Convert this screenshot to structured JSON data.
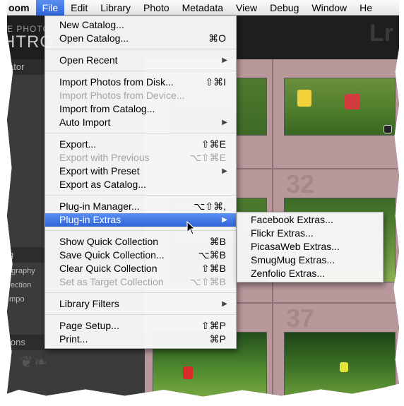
{
  "menubar": {
    "items": [
      {
        "label": "oom"
      },
      {
        "label": "File"
      },
      {
        "label": "Edit"
      },
      {
        "label": "Library"
      },
      {
        "label": "Photo"
      },
      {
        "label": "Metadata"
      },
      {
        "label": "View"
      },
      {
        "label": "Debug"
      },
      {
        "label": "Window"
      },
      {
        "label": "He"
      }
    ]
  },
  "background": {
    "brand_line1": "E PHOTO",
    "brand_line2": "HTRO",
    "panel_header_top": "ator",
    "panel_header_mid": "g",
    "panel_header_bottom": "ions",
    "panel_items": [
      "ography",
      "llection",
      "Impo"
    ],
    "grid_numbers": [
      "32",
      "37"
    ]
  },
  "file_menu": {
    "items": [
      {
        "label": "New Catalog...",
        "shortcut": "",
        "submenu": false,
        "disabled": false
      },
      {
        "label": "Open Catalog...",
        "shortcut": "⌘O",
        "submenu": false,
        "disabled": false
      },
      {
        "label": "Open Recent",
        "shortcut": "",
        "submenu": true,
        "disabled": false
      },
      {
        "label": "Import Photos from Disk...",
        "shortcut": "⇧⌘I",
        "submenu": false,
        "disabled": false
      },
      {
        "label": "Import Photos from Device...",
        "shortcut": "",
        "submenu": false,
        "disabled": true
      },
      {
        "label": "Import from Catalog...",
        "shortcut": "",
        "submenu": false,
        "disabled": false
      },
      {
        "label": "Auto Import",
        "shortcut": "",
        "submenu": true,
        "disabled": false
      },
      {
        "label": "Export...",
        "shortcut": "⇧⌘E",
        "submenu": false,
        "disabled": false
      },
      {
        "label": "Export with Previous",
        "shortcut": "⌥⇧⌘E",
        "submenu": false,
        "disabled": true
      },
      {
        "label": "Export with Preset",
        "shortcut": "",
        "submenu": true,
        "disabled": false
      },
      {
        "label": "Export as Catalog...",
        "shortcut": "",
        "submenu": false,
        "disabled": false
      },
      {
        "label": "Plug-in Manager...",
        "shortcut": "⌥⇧⌘,",
        "submenu": false,
        "disabled": false
      },
      {
        "label": "Plug-in Extras",
        "shortcut": "",
        "submenu": true,
        "disabled": false,
        "highlighted": true
      },
      {
        "label": "Show Quick Collection",
        "shortcut": "⌘B",
        "submenu": false,
        "disabled": false
      },
      {
        "label": "Save Quick Collection...",
        "shortcut": "⌥⌘B",
        "submenu": false,
        "disabled": false
      },
      {
        "label": "Clear Quick Collection",
        "shortcut": "⇧⌘B",
        "submenu": false,
        "disabled": false
      },
      {
        "label": "Set as Target Collection",
        "shortcut": "⌥⇧⌘B",
        "submenu": false,
        "disabled": true
      },
      {
        "label": "Library Filters",
        "shortcut": "",
        "submenu": true,
        "disabled": false
      },
      {
        "label": "Page Setup...",
        "shortcut": "⇧⌘P",
        "submenu": false,
        "disabled": false
      },
      {
        "label": "Print...",
        "shortcut": "⌘P",
        "submenu": false,
        "disabled": false
      }
    ]
  },
  "plugin_extras_submenu": {
    "items": [
      {
        "label": "Facebook Extras..."
      },
      {
        "label": "Flickr Extras..."
      },
      {
        "label": "PicasaWeb Extras..."
      },
      {
        "label": "SmugMug Extras..."
      },
      {
        "label": "Zenfolio Extras..."
      }
    ]
  },
  "colors": {
    "highlight": "#2f63d9",
    "menu_bg": "#f8f8f8",
    "grid_bg": "#b9989b",
    "panel_bg": "#3b3b3b"
  }
}
